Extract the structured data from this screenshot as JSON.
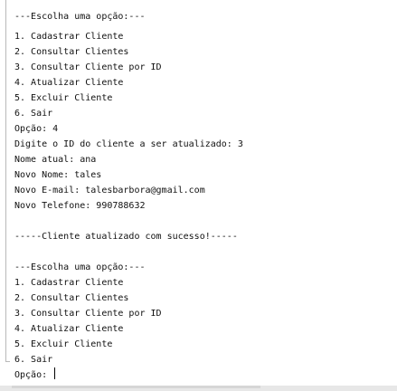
{
  "console": {
    "lines": [
      "---Escolha uma opção:---",
      "1. Cadastrar Cliente",
      "2. Consultar Clientes",
      "3. Consultar Cliente por ID",
      "4. Atualizar Cliente",
      "5. Excluir Cliente",
      "6. Sair",
      "Opção: 4",
      "Digite o ID do cliente a ser atualizado: 3",
      "Nome atual: ana",
      "Novo Nome: tales",
      "Novo E-mail: talesbarbora@gmail.com",
      "Novo Telefone: 990788632",
      "",
      "-----Cliente atualizado com sucesso!-----",
      "",
      "---Escolha uma opção:---",
      "1. Cadastrar Cliente",
      "2. Consultar Clientes",
      "3. Consultar Cliente por ID",
      "4. Atualizar Cliente",
      "5. Excluir Cliente",
      "6. Sair"
    ],
    "prompt": "Opção: "
  }
}
